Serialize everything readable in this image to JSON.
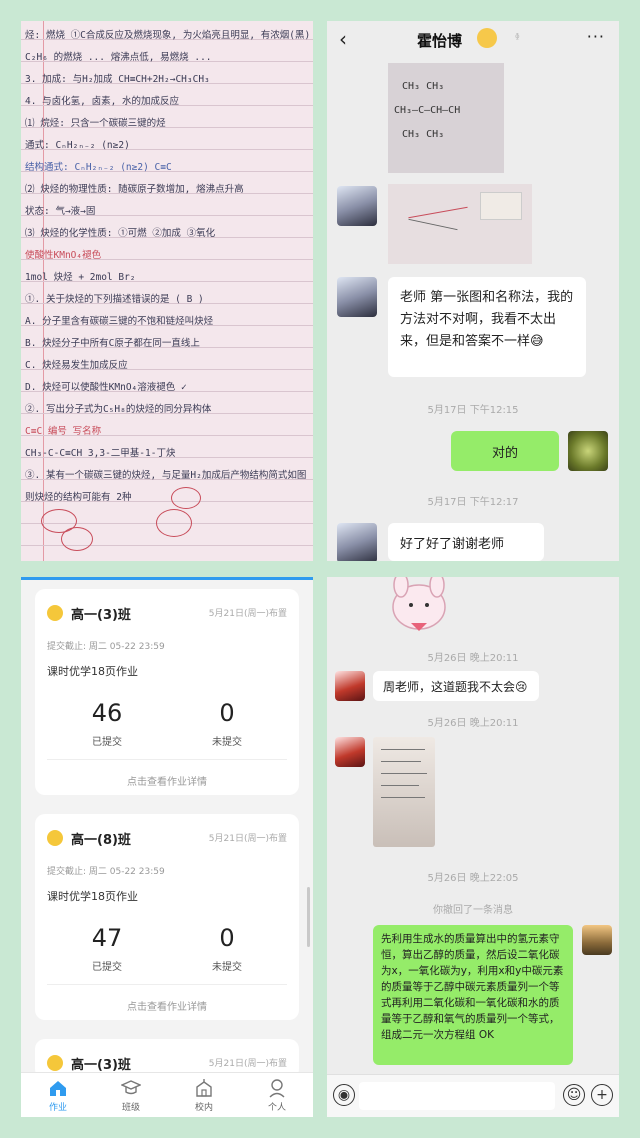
{
  "notes": {
    "lines": [
      {
        "text": "烃: 燃烧 ①C合成反应及燃烧现象, 为火焰亮且明显, 有浓烟(黑)",
        "color": "ink"
      },
      {
        "text": "  C₂H₆ 的燃烧 ... 熔沸点低, 易燃烧 ...",
        "color": "ink"
      },
      {
        "text": "3. 加成: 与H₂加成 CH≡CH+2H₂→CH₃CH₃",
        "color": "ink"
      },
      {
        "text": "4. 与卤化氢, 卤素, 水的加成反应",
        "color": "ink"
      },
      {
        "text": "⑴ 烷烃: 只含一个碳碳三键的烃",
        "color": "ink"
      },
      {
        "text": "  通式: CₙH₂ₙ₋₂ (n≥2)",
        "color": "ink"
      },
      {
        "text": "  结构通式: CₙH₂ₙ₋₂ (n≥2)  C≡C",
        "color": "blue"
      },
      {
        "text": "⑵ 炔烃的物理性质: 随碳原子数增加, 熔沸点升高",
        "color": "ink"
      },
      {
        "text": "   状态: 气→液→固",
        "color": "ink"
      },
      {
        "text": "⑶ 炔烃的化学性质: ①可燃 ②加成 ③氧化",
        "color": "ink"
      },
      {
        "text": "  使酸性KMnO₄褪色",
        "color": "red"
      },
      {
        "text": "  1mol 炔烃 + 2mol Br₂",
        "color": "ink"
      },
      {
        "text": "①. 关于炔烃的下列描述错误的是 ( B )",
        "color": "ink"
      },
      {
        "text": "  A. 分子里含有碳碳三键的不饱和链烃叫炔烃",
        "color": "ink"
      },
      {
        "text": "  B. 炔烃分子中所有C原子都在同一直线上",
        "color": "ink"
      },
      {
        "text": "  C. 炔烃易发生加成反应",
        "color": "ink"
      },
      {
        "text": "  D. 炔烃可以使酸性KMnO₄溶液褪色 ✓",
        "color": "ink"
      },
      {
        "text": "②. 写出分子式为C₅H₈的炔烃的同分异构体",
        "color": "ink"
      },
      {
        "text": "  C≡C 编号 写名称",
        "color": "red"
      },
      {
        "text": "  CH₃-C-C≡CH  3,3-二甲基-1-丁炔",
        "color": "ink"
      },
      {
        "text": "③. 某有一个碳碳三键的炔烃, 与足量H₂加成后产物结构简式如图",
        "color": "ink"
      },
      {
        "text": "  则炔烃的结构可能有 2种",
        "color": "ink"
      }
    ]
  },
  "chat1": {
    "back": "‹",
    "title": "霍怡博",
    "more": "···",
    "ear": "ᶲ",
    "chem_photo_1": [
      "CH₃    CH₃",
      "CH₃—C—CH—CH",
      "CH₃    CH₃"
    ],
    "message_text": "老师 第一张图和名称法，我的方法对不对啊，我看不太出来，但是和答案不一样😅",
    "time_1": "5月17日 下午12:15",
    "my_reply": "对的",
    "time_2": "5月17日 下午12:17",
    "last_message": "好了好了谢谢老师"
  },
  "homework": {
    "cards": [
      {
        "class": "高一(3)班",
        "date": "5月21日(周一)布置",
        "deadline": "提交截止: 周二 05-22 23:59",
        "title": "课时优学18页作业",
        "submitted": "46",
        "submitted_label": "已提交",
        "unsubmitted": "0",
        "unsubmitted_label": "未提交",
        "detail": "点击查看作业详情"
      },
      {
        "class": "高一(8)班",
        "date": "5月21日(周一)布置",
        "deadline": "提交截止: 周二 05-22 23:59",
        "title": "课时优学18页作业",
        "submitted": "47",
        "submitted_label": "已提交",
        "unsubmitted": "0",
        "unsubmitted_label": "未提交",
        "detail": "点击查看作业详情"
      },
      {
        "class": "高一(3)班",
        "date": "5月21日(周一)布置"
      }
    ],
    "nav": [
      {
        "label": "作业",
        "icon": "home-icon"
      },
      {
        "label": "班级",
        "icon": "class-icon"
      },
      {
        "label": "校内",
        "icon": "school-icon"
      },
      {
        "label": "个人",
        "icon": "person-icon"
      }
    ],
    "accent": "#2f9bef"
  },
  "chat2": {
    "time_1": "5月26日 晚上20:11",
    "message_1": "周老师，这道题我不太会😢",
    "time_2": "5月26日 晚上20:11",
    "time_3": "5月26日 晚上22:05",
    "recall": "你撤回了一条消息",
    "my_reply": "先利用生成水的质量算出中的氢元素守恒，算出乙醇的质量，然后设二氧化碳为x，一氧化碳为y，利用x和y中碳元素的质量等于乙醇中碳元素质量列一个等式再利用二氧化碳和一氧化碳和水的质量等于乙醇和氧气的质量列一个等式，组成二元一次方程组 OK"
  },
  "colors": {
    "background": "#c9e8d3",
    "wechat_green": "#95ec69",
    "chat_bg": "#ededed"
  }
}
